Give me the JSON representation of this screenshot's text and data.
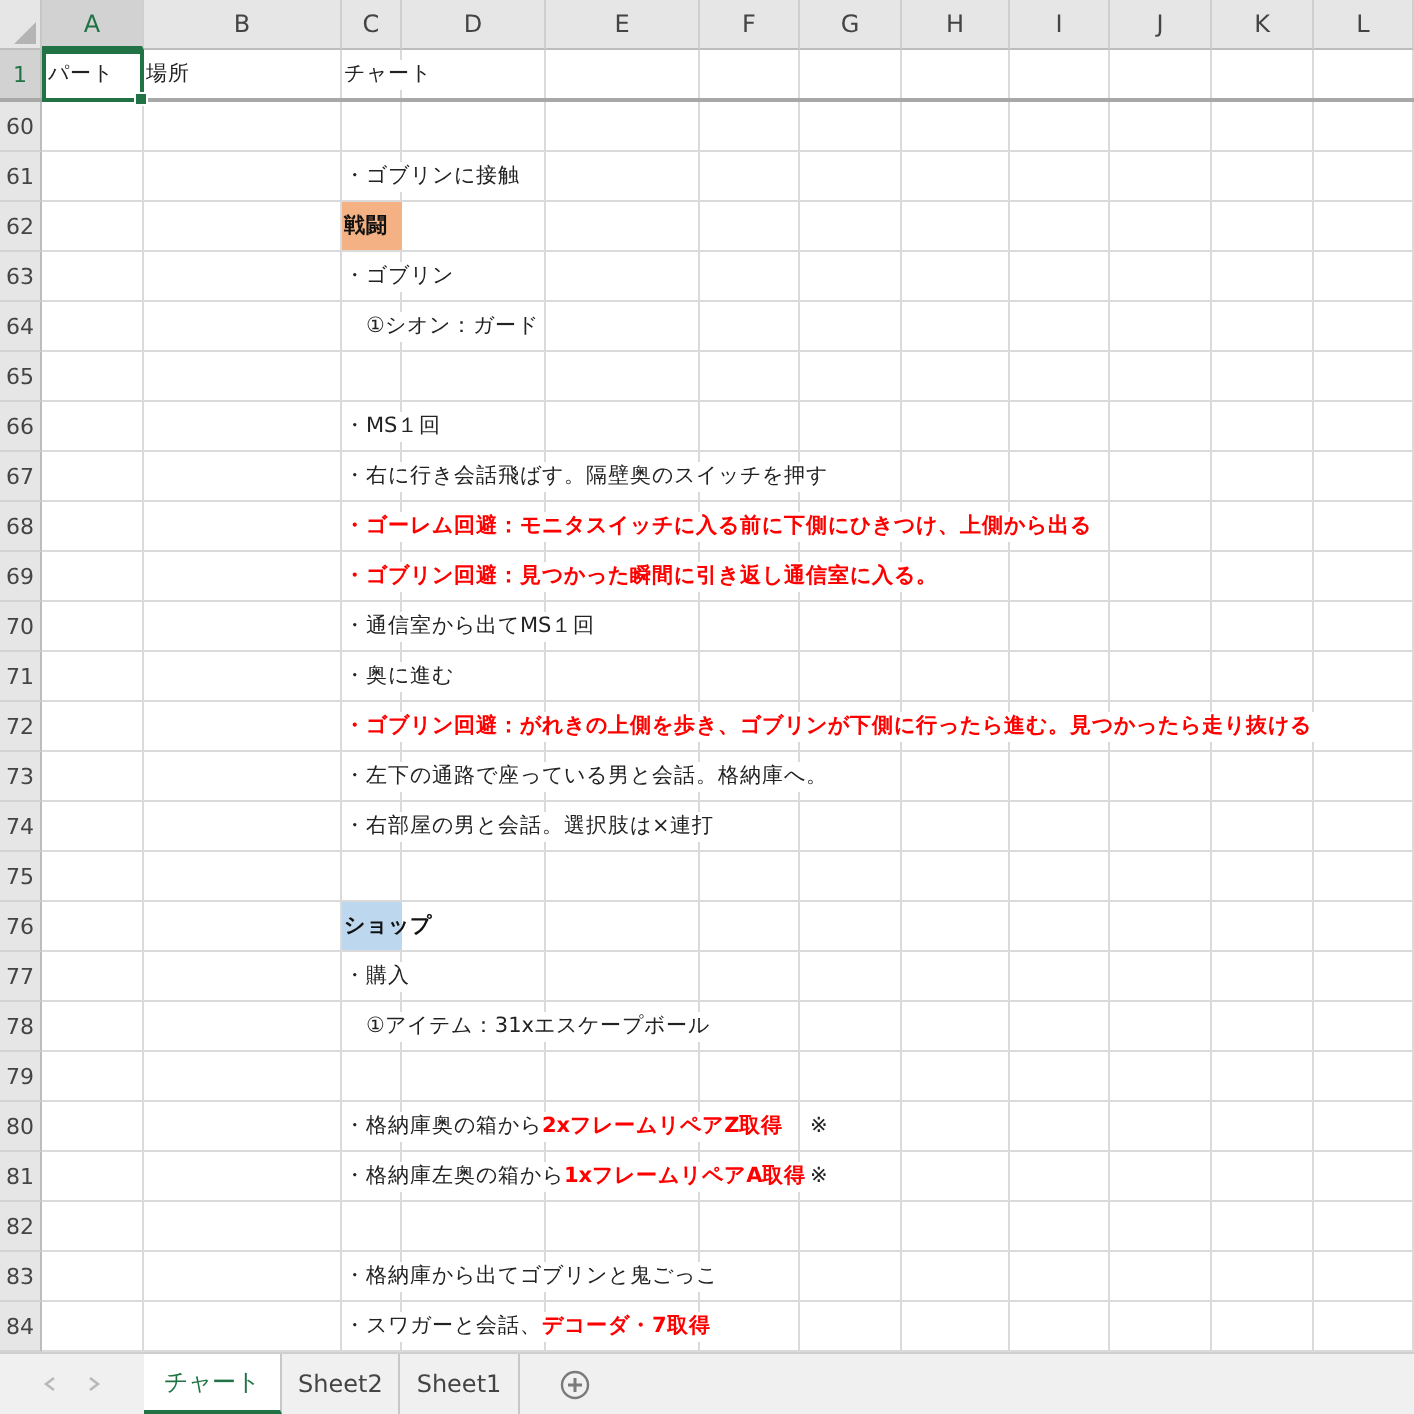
{
  "columns": [
    {
      "label": "A",
      "selected": true
    },
    {
      "label": "B",
      "selected": false
    },
    {
      "label": "C",
      "selected": false
    },
    {
      "label": "D",
      "selected": false
    },
    {
      "label": "E",
      "selected": false
    },
    {
      "label": "F",
      "selected": false
    },
    {
      "label": "G",
      "selected": false
    },
    {
      "label": "H",
      "selected": false
    },
    {
      "label": "I",
      "selected": false
    },
    {
      "label": "J",
      "selected": false
    },
    {
      "label": "K",
      "selected": false
    },
    {
      "label": "L",
      "selected": false
    }
  ],
  "header_row": {
    "number": "1",
    "selected": true,
    "cells": [
      {
        "text": "パート",
        "selected": true
      },
      {
        "text": "場所",
        "selected": false
      },
      {
        "text": "チャート",
        "selected": false
      }
    ]
  },
  "rows": [
    {
      "number": "60"
    },
    {
      "number": "61",
      "c": {
        "runs": [
          {
            "text": "・ゴブリンに接触",
            "kind": "plain"
          }
        ]
      }
    },
    {
      "number": "62",
      "c": {
        "runs": [
          {
            "text": "戦闘",
            "kind": "heading"
          }
        ],
        "color": "#f4b183"
      }
    },
    {
      "number": "63",
      "c": {
        "runs": [
          {
            "text": "・ゴブリン",
            "kind": "plain"
          }
        ]
      }
    },
    {
      "number": "64",
      "c": {
        "runs": [
          {
            "text": "　①シオン：ガード",
            "kind": "plain"
          }
        ]
      }
    },
    {
      "number": "65"
    },
    {
      "number": "66",
      "c": {
        "runs": [
          {
            "text": "・MS１回",
            "kind": "plain"
          }
        ]
      }
    },
    {
      "number": "67",
      "c": {
        "runs": [
          {
            "text": "・右に行き会話飛ばす。隔壁奥のスイッチを押す",
            "kind": "plain"
          }
        ]
      }
    },
    {
      "number": "68",
      "c": {
        "runs": [
          {
            "text": "・ゴーレム回避：モニタスイッチに入る前に下側にひきつけ、上側から出る",
            "kind": "alert"
          }
        ]
      }
    },
    {
      "number": "69",
      "c": {
        "runs": [
          {
            "text": "・ゴブリン回避：見つかった瞬間に引き返し通信室に入る。",
            "kind": "alert"
          }
        ]
      }
    },
    {
      "number": "70",
      "c": {
        "runs": [
          {
            "text": "・通信室から出てMS１回",
            "kind": "plain"
          }
        ]
      }
    },
    {
      "number": "71",
      "c": {
        "runs": [
          {
            "text": "・奥に進む",
            "kind": "plain"
          }
        ]
      }
    },
    {
      "number": "72",
      "c": {
        "runs": [
          {
            "text": "・ゴブリン回避：がれきの上側を歩き、ゴブリンが下側に行ったら進む。見つかったら走り抜ける",
            "kind": "alert"
          }
        ]
      }
    },
    {
      "number": "73",
      "c": {
        "runs": [
          {
            "text": "・左下の通路で座っている男と会話。格納庫へ。",
            "kind": "plain"
          }
        ]
      }
    },
    {
      "number": "74",
      "c": {
        "runs": [
          {
            "text": "・右部屋の男と会話。選択肢は×連打",
            "kind": "plain"
          }
        ]
      }
    },
    {
      "number": "75"
    },
    {
      "number": "76",
      "c": {
        "runs": [
          {
            "text": "ショップ",
            "kind": "heading"
          }
        ],
        "color": "#bdd7ee"
      }
    },
    {
      "number": "77",
      "c": {
        "runs": [
          {
            "text": "・購入",
            "kind": "plain"
          }
        ]
      }
    },
    {
      "number": "78",
      "c": {
        "runs": [
          {
            "text": "　①アイテム：31xエスケープボール",
            "kind": "plain"
          }
        ]
      }
    },
    {
      "number": "79"
    },
    {
      "number": "80",
      "c": {
        "runs": [
          {
            "text": "・格納庫奥の箱から",
            "kind": "plain"
          },
          {
            "text": "2xフレームリペアZ取得",
            "kind": "alert"
          }
        ]
      },
      "g": {
        "runs": [
          {
            "text": "※",
            "kind": "plain"
          }
        ]
      }
    },
    {
      "number": "81",
      "c": {
        "runs": [
          {
            "text": "・格納庫左奥の箱から",
            "kind": "plain"
          },
          {
            "text": "1xフレームリペアA取得",
            "kind": "alert"
          }
        ]
      },
      "g": {
        "runs": [
          {
            "text": "※",
            "kind": "plain"
          }
        ]
      }
    },
    {
      "number": "82"
    },
    {
      "number": "83",
      "c": {
        "runs": [
          {
            "text": "・格納庫から出てゴブリンと鬼ごっこ",
            "kind": "plain"
          }
        ]
      }
    },
    {
      "number": "84",
      "c": {
        "runs": [
          {
            "text": "・スワガーと会話、",
            "kind": "plain"
          },
          {
            "text": "デコーダ・7取得",
            "kind": "alert"
          }
        ]
      }
    }
  ],
  "sheet_tabs": [
    {
      "label": "チャート",
      "selected": true
    },
    {
      "label": "Sheet2",
      "selected": false
    },
    {
      "label": "Sheet1",
      "selected": false
    }
  ]
}
